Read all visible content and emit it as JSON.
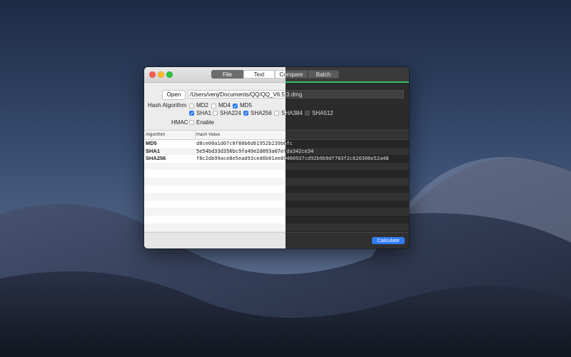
{
  "window": {
    "tabs": [
      {
        "label": "File",
        "active": true
      },
      {
        "label": "Text",
        "active": false
      },
      {
        "label": "Compare",
        "active": false
      },
      {
        "label": "Batch",
        "active": false
      }
    ]
  },
  "file": {
    "open_label": "Open",
    "path": "/Users/venj/Documents/QQ/QQ_V6.5.3.dmg"
  },
  "options": {
    "hash_algorithm_label": "Hash Algorithm",
    "algorithms": [
      {
        "label": "MD2",
        "checked": false
      },
      {
        "label": "MD4",
        "checked": false
      },
      {
        "label": "MD5",
        "checked": true
      },
      {
        "label": "SHA1",
        "checked": true
      },
      {
        "label": "SHA224",
        "checked": false
      },
      {
        "label": "SHA256",
        "checked": true
      },
      {
        "label": "SHA384",
        "checked": false
      },
      {
        "label": "SHA512",
        "checked": false
      }
    ],
    "hmac_label": "HMAC",
    "hmac_enable_label": "Enable",
    "hmac_enabled": false
  },
  "table": {
    "headers": {
      "algorithm": "Algorithm",
      "hash": "Hash Value"
    },
    "rows": [
      {
        "algorithm": "MD5",
        "hash": "d8ce00a1d07c8f80b6d61952b239b6fc"
      },
      {
        "algorithm": "SHA1",
        "hash": "5e54bd33d356bc9fa49e2d093a07efda342ce34"
      },
      {
        "algorithm": "SHA256",
        "hash": "f8c2db99ace8e5ead93ced6b01ee89460937cd92b9b9df783f2c620306e52a48"
      }
    ]
  },
  "footer": {
    "calculate_label": "Calculate"
  },
  "colors": {
    "accent": "#2f7bf6",
    "dark_mode_divider": "#2fbf6b"
  }
}
